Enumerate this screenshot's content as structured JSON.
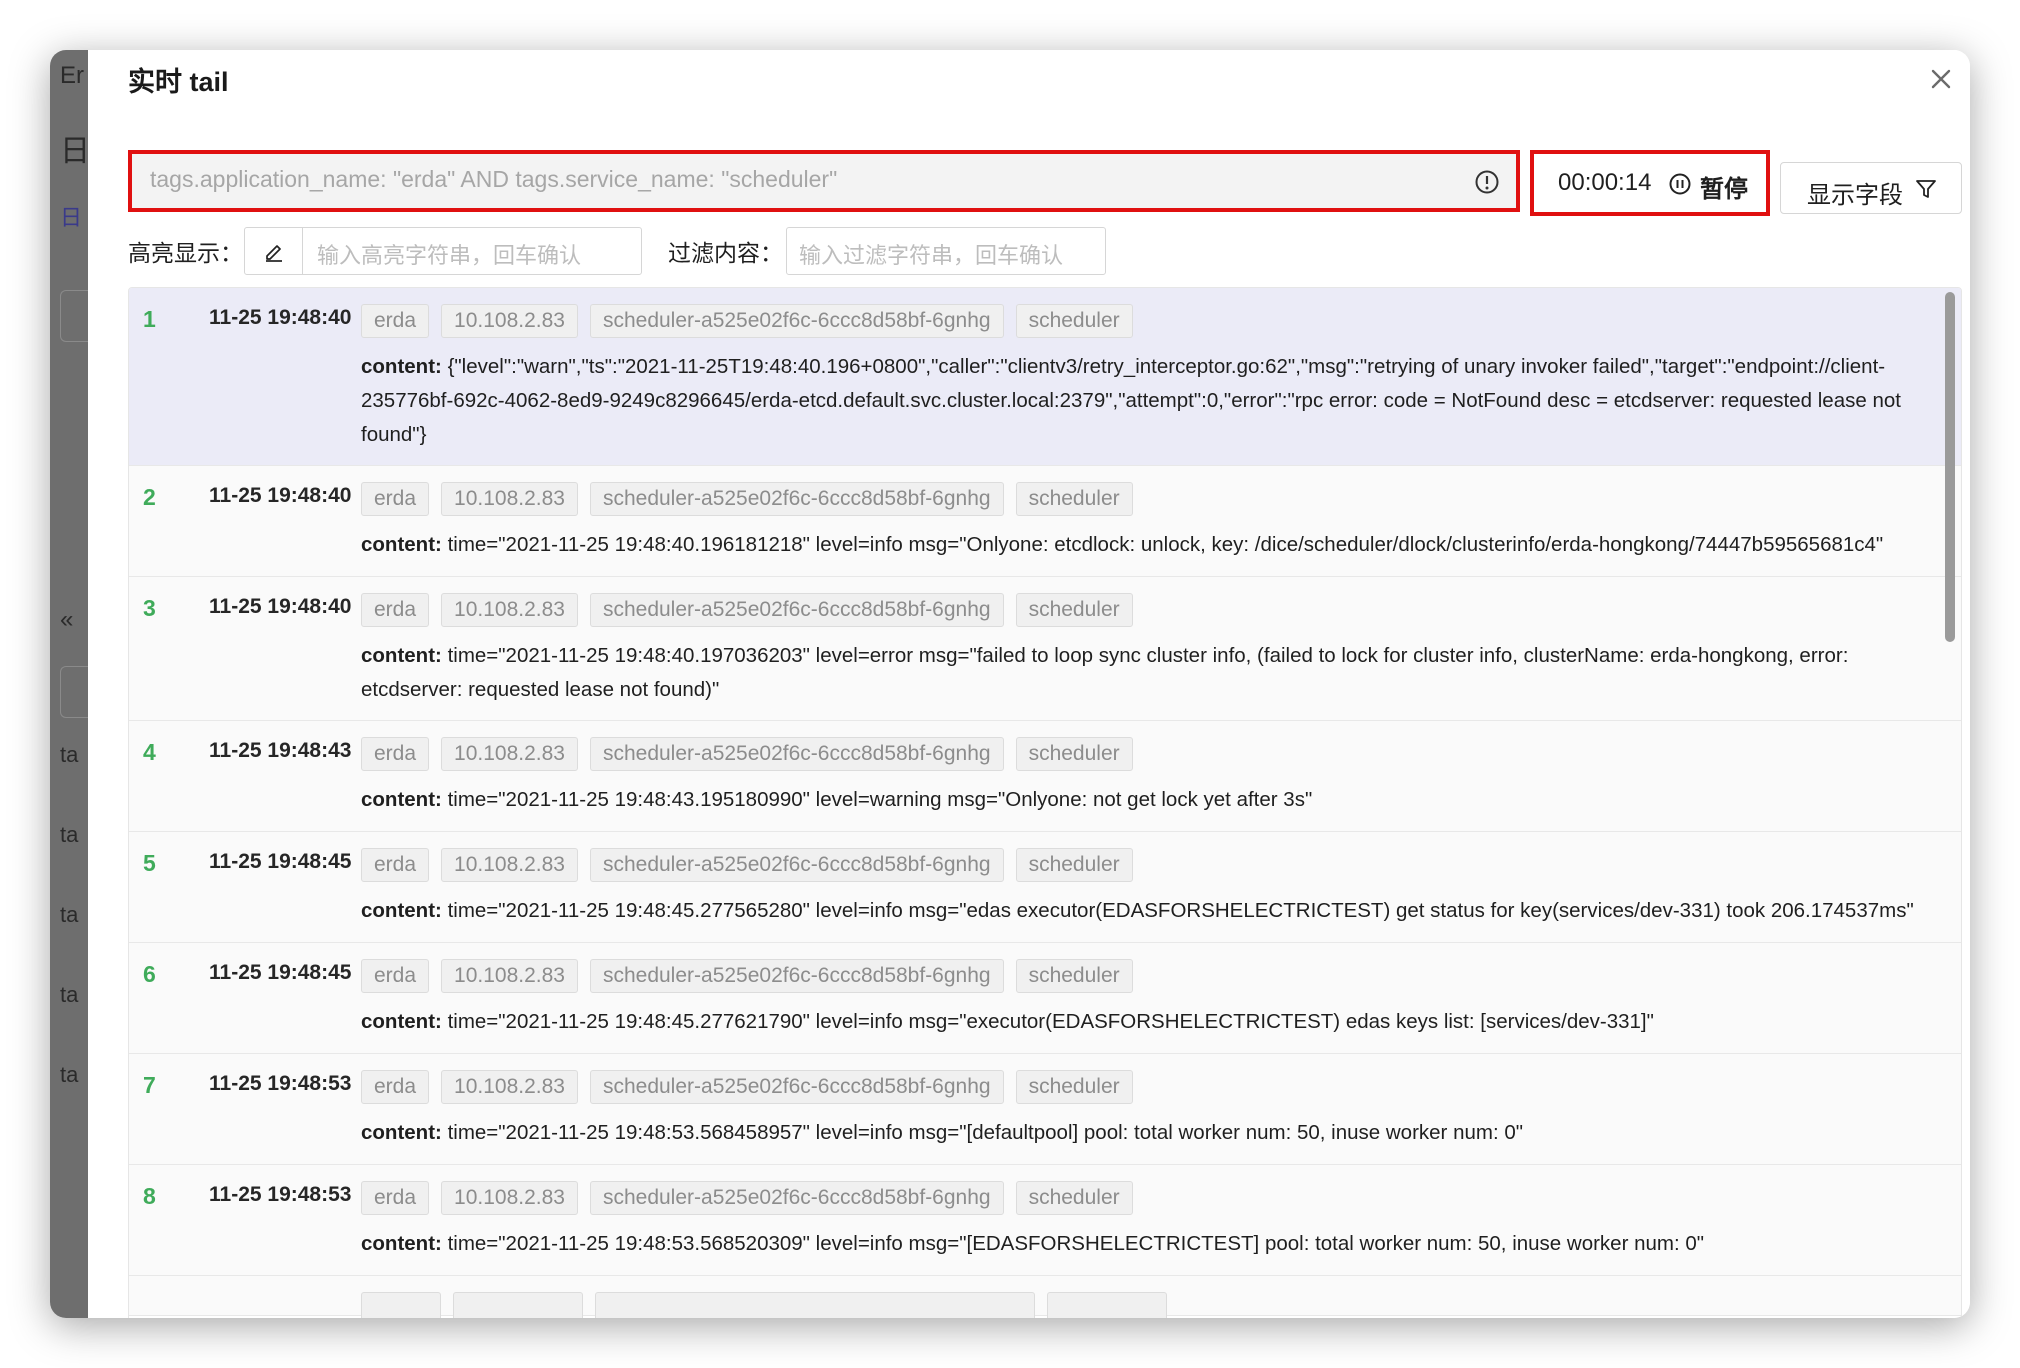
{
  "modal": {
    "title": "实时 tail",
    "query_placeholder": "tags.application_name: \"erda\" AND tags.service_name: \"scheduler\"",
    "timer": "00:00:14",
    "pause_label": "暂停",
    "fields_label": "显示字段",
    "highlight_label": "高亮显示：",
    "highlight_placeholder": "输入高亮字符串，回车确认",
    "filter_label": "过滤内容：",
    "filter_placeholder": "输入过滤字符串，回车确认"
  },
  "backdrop": {
    "glyphs": [
      "Er",
      "日",
      "日",
      "«",
      "ta",
      "ta",
      "ta",
      "ta",
      "ta"
    ]
  },
  "content_key": "content:",
  "logs": [
    {
      "num": "1",
      "time": "11-25 19:48:40",
      "tags": [
        "erda",
        "10.108.2.83",
        "scheduler-a525e02f6c-6ccc8d58bf-6gnhg",
        "scheduler"
      ],
      "content": "{\"level\":\"warn\",\"ts\":\"2021-11-25T19:48:40.196+0800\",\"caller\":\"clientv3/retry_interceptor.go:62\",\"msg\":\"retrying of unary invoker failed\",\"target\":\"endpoint://client-235776bf-692c-4062-8ed9-9249c8296645/erda-etcd.default.svc.cluster.local:2379\",\"attempt\":0,\"error\":\"rpc error: code = NotFound desc = etcdserver: requested lease not found\"}"
    },
    {
      "num": "2",
      "time": "11-25 19:48:40",
      "tags": [
        "erda",
        "10.108.2.83",
        "scheduler-a525e02f6c-6ccc8d58bf-6gnhg",
        "scheduler"
      ],
      "content": "time=\"2021-11-25 19:48:40.196181218\" level=info msg=\"Onlyone: etcdlock: unlock, key: /dice/scheduler/dlock/clusterinfo/erda-hongkong/74447b59565681c4\""
    },
    {
      "num": "3",
      "time": "11-25 19:48:40",
      "tags": [
        "erda",
        "10.108.2.83",
        "scheduler-a525e02f6c-6ccc8d58bf-6gnhg",
        "scheduler"
      ],
      "content": "time=\"2021-11-25 19:48:40.197036203\" level=error msg=\"failed to loop sync cluster info, (failed to lock for cluster info, clusterName: erda-hongkong, error: etcdserver: requested lease not found)\""
    },
    {
      "num": "4",
      "time": "11-25 19:48:43",
      "tags": [
        "erda",
        "10.108.2.83",
        "scheduler-a525e02f6c-6ccc8d58bf-6gnhg",
        "scheduler"
      ],
      "content": "time=\"2021-11-25 19:48:43.195180990\" level=warning msg=\"Onlyone: not get lock yet after 3s\""
    },
    {
      "num": "5",
      "time": "11-25 19:48:45",
      "tags": [
        "erda",
        "10.108.2.83",
        "scheduler-a525e02f6c-6ccc8d58bf-6gnhg",
        "scheduler"
      ],
      "content": "time=\"2021-11-25 19:48:45.277565280\" level=info msg=\"edas executor(EDASFORSHELECTRICTEST) get status for key(services/dev-331) took 206.174537ms\""
    },
    {
      "num": "6",
      "time": "11-25 19:48:45",
      "tags": [
        "erda",
        "10.108.2.83",
        "scheduler-a525e02f6c-6ccc8d58bf-6gnhg",
        "scheduler"
      ],
      "content": "time=\"2021-11-25 19:48:45.277621790\" level=info msg=\"executor(EDASFORSHELECTRICTEST) edas keys list: [services/dev-331]\""
    },
    {
      "num": "7",
      "time": "11-25 19:48:53",
      "tags": [
        "erda",
        "10.108.2.83",
        "scheduler-a525e02f6c-6ccc8d58bf-6gnhg",
        "scheduler"
      ],
      "content": "time=\"2021-11-25 19:48:53.568458957\" level=info msg=\"[defaultpool] pool: total worker num: 50, inuse worker num: 0\""
    },
    {
      "num": "8",
      "time": "11-25 19:48:53",
      "tags": [
        "erda",
        "10.108.2.83",
        "scheduler-a525e02f6c-6ccc8d58bf-6gnhg",
        "scheduler"
      ],
      "content": "time=\"2021-11-25 19:48:53.568520309\" level=info msg=\"[EDASFORSHELECTRICTEST] pool: total worker num: 50, inuse worker num: 0\""
    },
    {
      "num": "",
      "time": "",
      "tags": [
        "",
        "",
        "",
        ""
      ],
      "content": ""
    }
  ]
}
